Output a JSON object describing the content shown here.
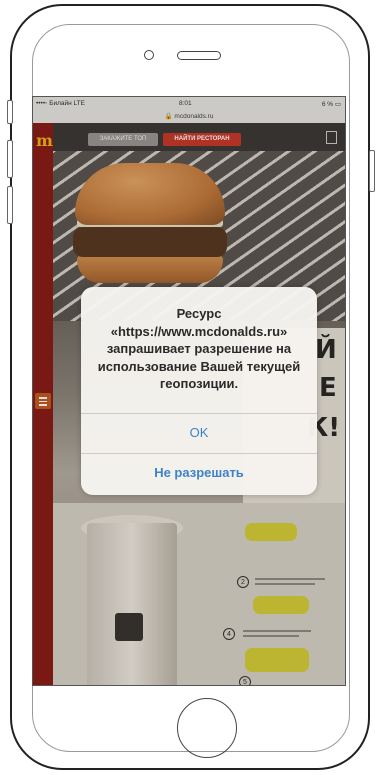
{
  "status_bar": {
    "carrier": "••••◦ Билайн LTE",
    "time": "8:01",
    "battery": "6 % ▭"
  },
  "address_bar": {
    "url": "🔒 mcdonalds.ru"
  },
  "site": {
    "logo": "m",
    "order_button": "ЗАКАЖИТЕ ТОП",
    "find_button": "НАЙТИ РЕСТОРАН",
    "headline_letters": [
      "Й",
      "Е",
      "К!"
    ],
    "steps": [
      "2",
      "4",
      "5"
    ]
  },
  "alert": {
    "message": "Ресурс «https://www.mcdonalds.ru» запрашивает разрешение на использование Вашей текущей геопозиции.",
    "ok_label": "OK",
    "deny_label": "Не разрешать"
  },
  "colors": {
    "brand_red": "#8b1c16",
    "brand_yellow": "#f2b51b",
    "alert_button": "#3f82c8"
  }
}
